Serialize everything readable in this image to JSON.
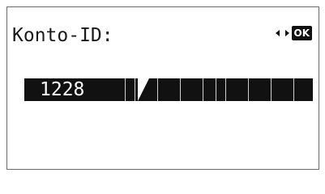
{
  "screen": {
    "title": "Konto-ID:",
    "nav": {
      "left_icon": "arrow-left-icon",
      "right_icon": "arrow-right-icon",
      "ok_label": "OK"
    },
    "input": {
      "value": "1228"
    }
  }
}
